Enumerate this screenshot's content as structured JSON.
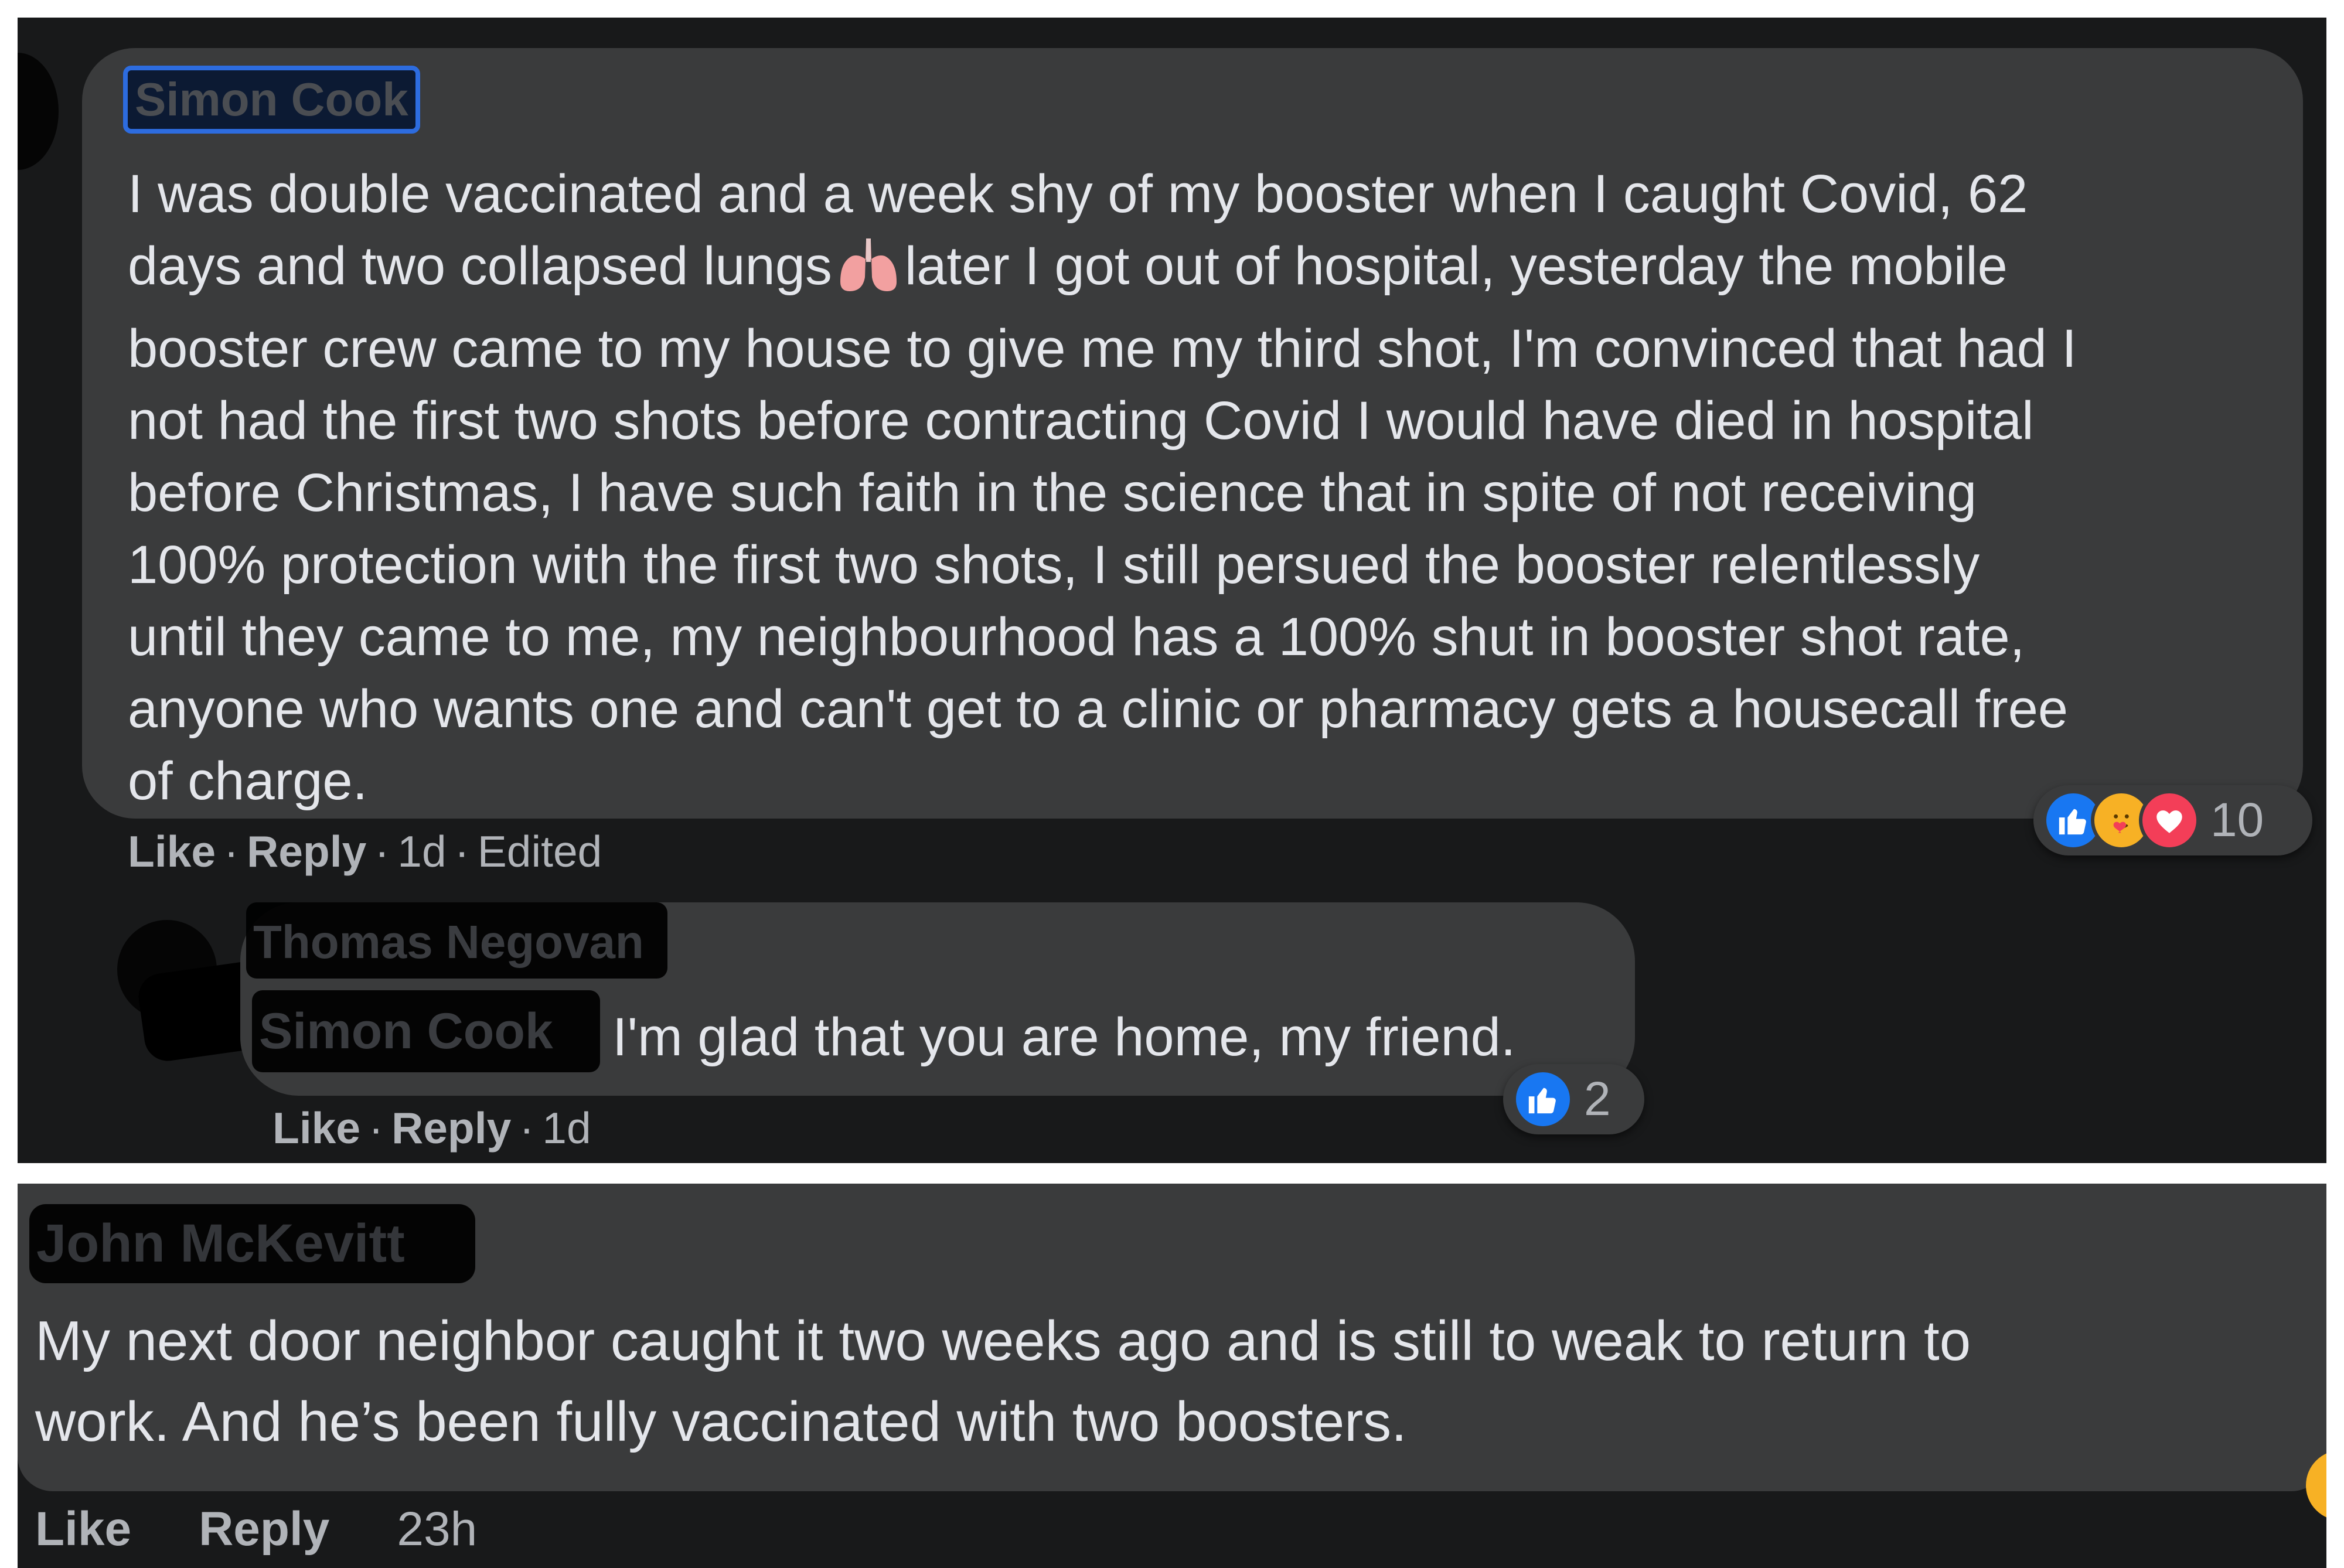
{
  "comments": [
    {
      "author": "Simon Cook",
      "lines": [
        "I was double vaccinated and a week shy of my booster when I caught Covid, 62",
        "days and two collapsed lungs",
        "booster crew came to my house to give me my third shot, I'm convinced that had I",
        "not had the first two shots before contracting Covid I would have died in hospital",
        "before Christmas, I have such faith in the science that in spite of not receiving",
        "100% protection with the first two shots, I still persued the booster relentlessly",
        "until they came to me, my neighbourhood has a 100% shut in booster shot rate,",
        "anyone who wants one and can't get to a clinic or pharmacy gets a housecall free",
        "of charge."
      ],
      "line2_after_emoji": "later I got out of hospital, yesterday the mobile",
      "emoji": "lungs-icon",
      "actions": {
        "like": "Like",
        "reply": "Reply",
        "time": "1d",
        "edited": "Edited",
        "sep": "·"
      },
      "reactions": {
        "icons": [
          "like-icon",
          "care-icon",
          "love-icon"
        ],
        "count": "10"
      }
    },
    {
      "author": "Thomas Negovan",
      "mention": "Simon Cook",
      "text": "I'm glad that you are home, my friend.",
      "actions": {
        "like": "Like",
        "reply": "Reply",
        "time": "1d",
        "sep": "·"
      },
      "reactions": {
        "icons": [
          "like-icon"
        ],
        "count": "2"
      }
    },
    {
      "author": "John McKevitt",
      "lines": [
        "My next door neighbor caught it two weeks ago and is still to weak to return to",
        "work. And he’s been fully vaccinated with two boosters."
      ],
      "actions": {
        "like": "Like",
        "reply": "Reply",
        "time": "23h"
      }
    }
  ],
  "colors": {
    "panel": "#18191a",
    "bubble": "#3a3b3c",
    "text": "#e4e6eb",
    "meta": "#b0b3b8",
    "like": "#1877f2",
    "love": "#f33e58",
    "care": "#f7b125"
  }
}
